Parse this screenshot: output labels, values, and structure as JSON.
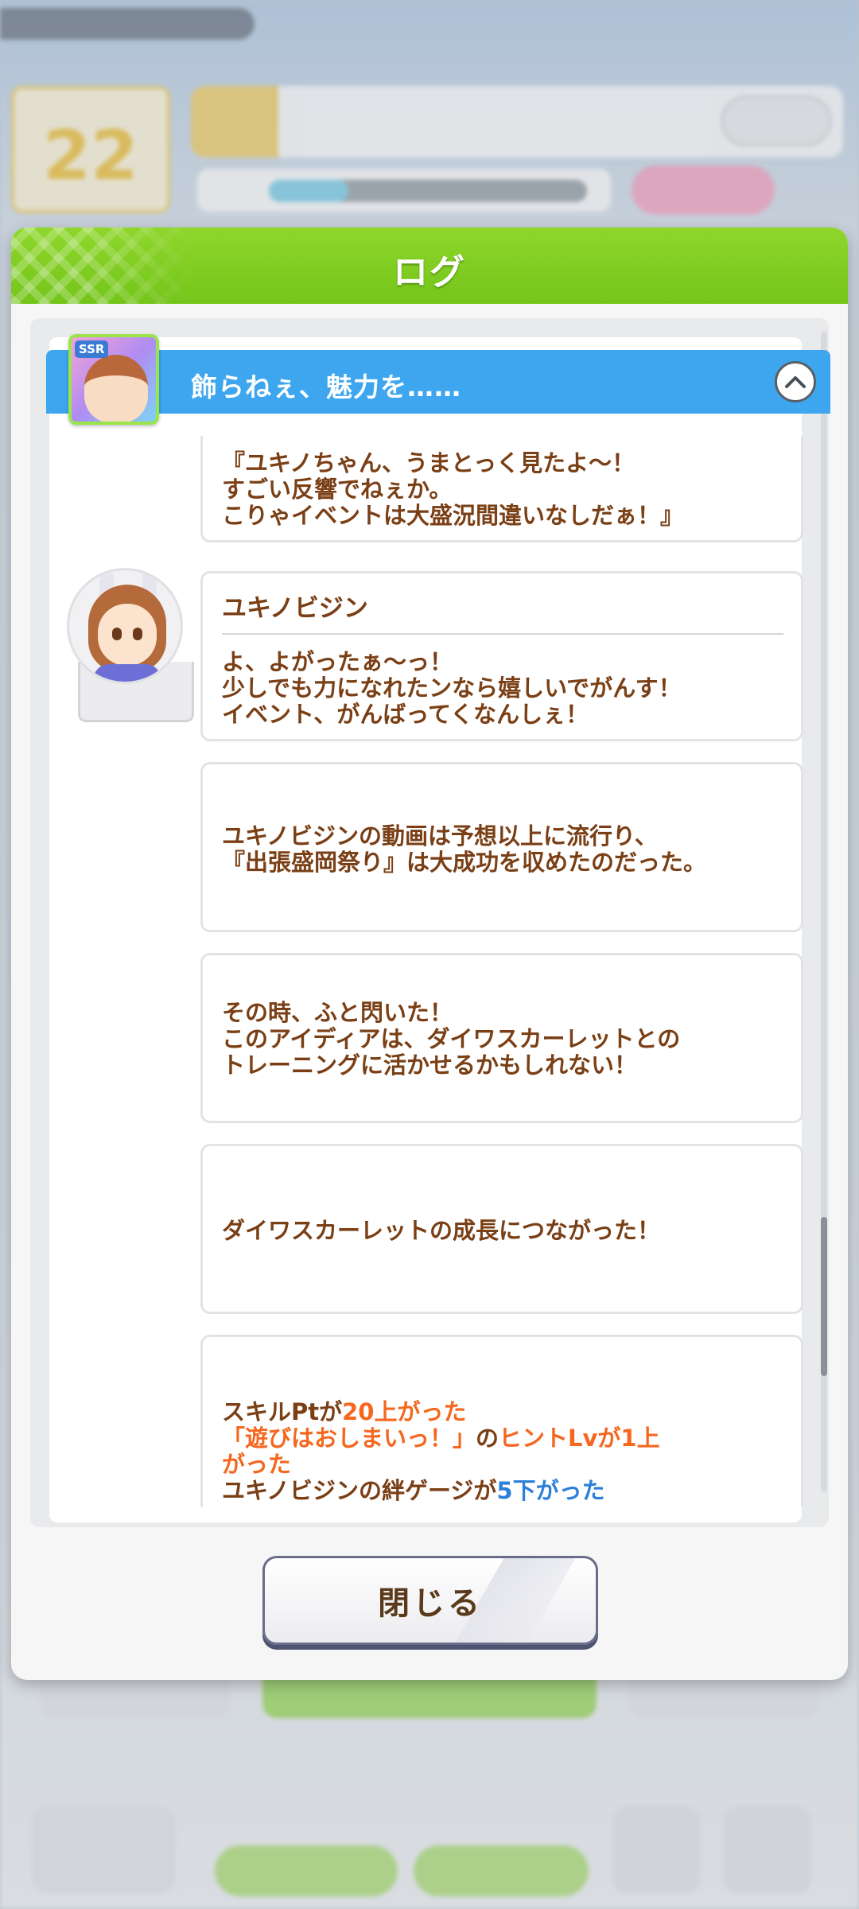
{
  "dialog": {
    "title": "ログ",
    "close_label": "閉じる"
  },
  "event": {
    "title": "飾らねぇ、魅力を……",
    "card_rarity": "SSR"
  },
  "entries": [
    {
      "text": "『ユキノちゃん、うまとっく見たよ～！\nすごい反響でねぇか。\nこりゃイベントは大盛況間違いなしだぁ！』"
    },
    {
      "speaker": "ユキノビジン",
      "text": "よ、よがったぁ～っ！\n少しでも力になれたンなら嬉しいでがんす！\nイベント、がんばってくなんしぇ！"
    },
    {
      "text": "ユキノビジンの動画は予想以上に流行り、\n『出張盛岡祭り』は大成功を収めたのだった。"
    },
    {
      "text": "その時、ふと閃いた！\nこのアイディアは、ダイワスカーレットとの\nトレーニングに活かせるかもしれない！"
    },
    {
      "text": "ダイワスカーレットの成長につながった！"
    }
  ],
  "result": {
    "line1_prefix": "スキルPtが",
    "line1_value": "20上がった",
    "line2_skill": "「遊びはおしまいっ！」",
    "line2_mid": "の",
    "line2_value_a": "ヒントLvが1上",
    "line2_value_b": "がった",
    "line3_prefix": "ユキノビジンの絆ゲージが",
    "line3_value": "5下がった"
  },
  "colors": {
    "header_green": "#74c51a",
    "event_blue": "#3ea6ee",
    "text_brown": "#7a3f15",
    "highlight_orange": "#f5671f",
    "highlight_blue": "#2d7fd9"
  }
}
